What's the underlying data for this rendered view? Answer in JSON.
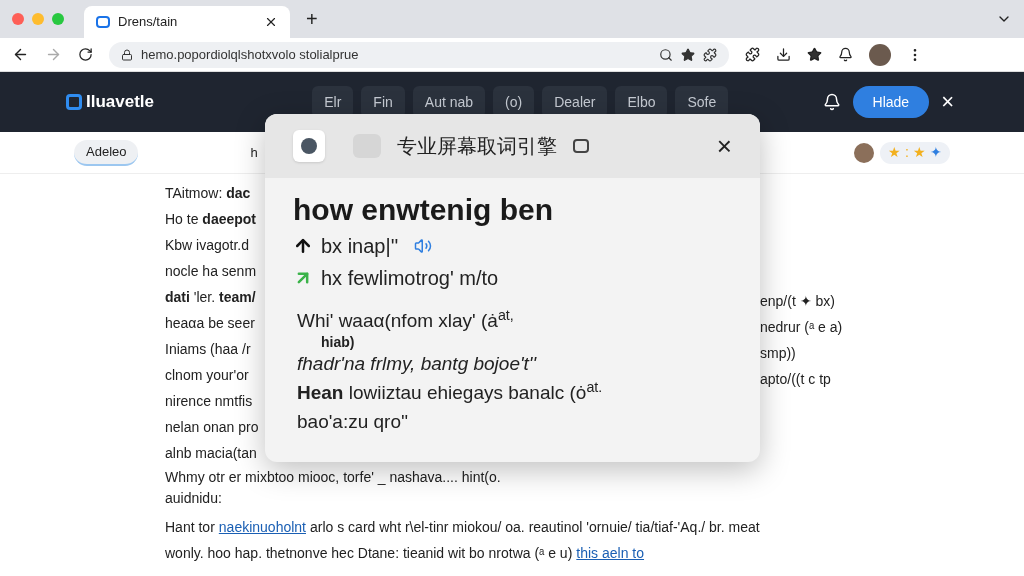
{
  "browser": {
    "tab": {
      "title": "Drens/tain",
      "selected": true
    },
    "new_tab": "+",
    "address": "hemo.popordiolqlshotxvolo stolialprue"
  },
  "site": {
    "logo": "Iluavetle",
    "nav": [
      "Elr",
      "Fin",
      "Aut nab",
      "(o)",
      "Dealer",
      "Elbo",
      "Sofe"
    ],
    "cta": "Hlade",
    "close": "×"
  },
  "subbar": {
    "tabs": [
      {
        "label": "Adeleo",
        "selected": true
      },
      {
        "label": "h",
        "selected": false
      }
    ],
    "stars": [
      "★",
      ":",
      "★",
      "✦"
    ]
  },
  "article": {
    "left_lines": [
      {
        "text": "TAitmow: **dac**"
      },
      {
        "text": "Ho te **daeepot**"
      },
      {
        "text": "Kbw ivagotr.d"
      },
      {
        "text": "nocle ha senm"
      },
      {
        "text": "**dati** 'ler. **team/**"
      },
      {
        "text": "heaαa be seer"
      },
      {
        "text": "Iniams (haa /r"
      },
      {
        "text": "clnom your'or"
      },
      {
        "text": "nirence nmtfis"
      },
      {
        "text": "nelan onan pro"
      },
      {
        "text": "alnb macia(tan"
      }
    ],
    "right_lines": [
      "enp/(t ✦ bx)",
      "nedrur (ᵃ e a)",
      "smp))",
      "apto/((t c tp"
    ],
    "full_lines": [
      {
        "parts": [
          {
            "text": "Whmy otr er mixbtoo mioοc, torfe' _ nashava.... hint(o.",
            "link": false
          }
        ]
      },
      {
        "parts": [
          {
            "text": "auidnidu:",
            "link": false
          }
        ]
      },
      {
        "parts": [
          {
            "text": "Hant tor",
            "link": false
          },
          {
            "text": "naekinuoholnt",
            "link": true
          },
          {
            "text": "arlo s card wht r\\el-tinr miokou/ oa. reautinol 'ornuie/ tia/tiaf-'Aq./ br. meat",
            "link": false
          }
        ]
      },
      {
        "parts": [
          {
            "text": "wonly. hoo hap. thetnonve hec Dtane: tieanid wit bo nrotwa (ᵃ e u)",
            "link": false
          },
          {
            "text": "this aeln to",
            "link": true
          }
        ]
      }
    ]
  },
  "popup": {
    "title": "专业屏幕取词引擎",
    "close": "×",
    "word": "how enwtenig ben",
    "pronunciations": [
      {
        "kind": "uk",
        "text": "bx inap|''",
        "audio": true
      },
      {
        "kind": "us",
        "text": "hx fewlimotrog'  m/to",
        "audio": false
      }
    ],
    "definitions": [
      "Whi' waaα(nfom  xlay' (ȧ$^{at,}$",
      "fhadr'na frlmy,  bantg bojoe't''",
      "**Hean** lowiiztau ehiegays banalc (ȯ$^{at.}$",
      "bao'a:zu  qro''"
    ],
    "note": "hiab)"
  }
}
